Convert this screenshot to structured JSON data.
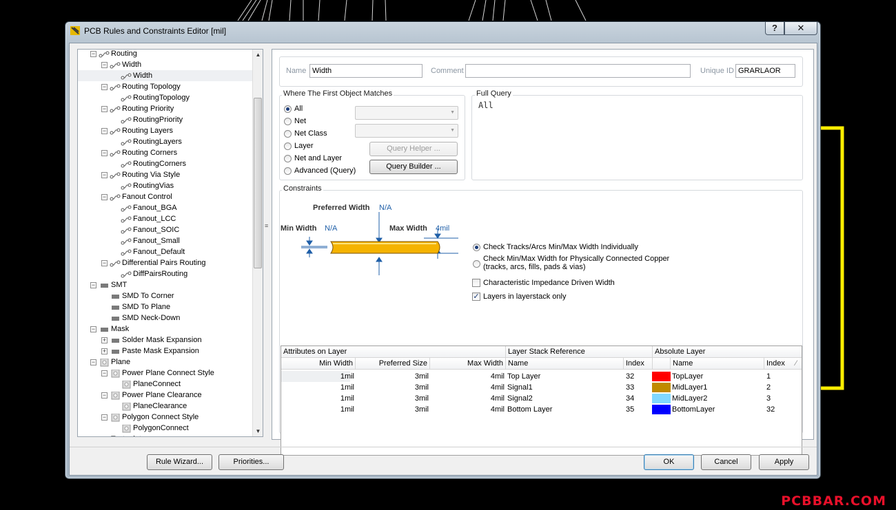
{
  "window": {
    "title": "PCB Rules and Constraints Editor [mil]",
    "help_label": "?",
    "close_label": "✕"
  },
  "watermark": "PCBBAR.COM",
  "tree": {
    "items": [
      {
        "label": "Routing",
        "level": 0,
        "icon": "rule-category-icon",
        "expander": "−"
      },
      {
        "label": "Width",
        "level": 1,
        "icon": "rule-category-icon",
        "expander": "−"
      },
      {
        "label": "Width",
        "level": 2,
        "icon": "rule-icon",
        "expander": "",
        "selected": true
      },
      {
        "label": "Routing Topology",
        "level": 1,
        "icon": "rule-category-icon",
        "expander": "−"
      },
      {
        "label": "RoutingTopology",
        "level": 2,
        "icon": "rule-icon",
        "expander": ""
      },
      {
        "label": "Routing Priority",
        "level": 1,
        "icon": "rule-category-icon",
        "expander": "−"
      },
      {
        "label": "RoutingPriority",
        "level": 2,
        "icon": "rule-icon",
        "expander": ""
      },
      {
        "label": "Routing Layers",
        "level": 1,
        "icon": "rule-category-icon",
        "expander": "−"
      },
      {
        "label": "RoutingLayers",
        "level": 2,
        "icon": "rule-icon",
        "expander": ""
      },
      {
        "label": "Routing Corners",
        "level": 1,
        "icon": "rule-category-icon",
        "expander": "−"
      },
      {
        "label": "RoutingCorners",
        "level": 2,
        "icon": "rule-icon",
        "expander": ""
      },
      {
        "label": "Routing Via Style",
        "level": 1,
        "icon": "rule-category-icon",
        "expander": "−"
      },
      {
        "label": "RoutingVias",
        "level": 2,
        "icon": "rule-icon",
        "expander": ""
      },
      {
        "label": "Fanout Control",
        "level": 1,
        "icon": "rule-category-icon",
        "expander": "−"
      },
      {
        "label": "Fanout_BGA",
        "level": 2,
        "icon": "rule-icon",
        "expander": ""
      },
      {
        "label": "Fanout_LCC",
        "level": 2,
        "icon": "rule-icon",
        "expander": ""
      },
      {
        "label": "Fanout_SOIC",
        "level": 2,
        "icon": "rule-icon",
        "expander": ""
      },
      {
        "label": "Fanout_Small",
        "level": 2,
        "icon": "rule-icon",
        "expander": ""
      },
      {
        "label": "Fanout_Default",
        "level": 2,
        "icon": "rule-icon",
        "expander": ""
      },
      {
        "label": "Differential Pairs Routing",
        "level": 1,
        "icon": "rule-category-icon",
        "expander": "−"
      },
      {
        "label": "DiffPairsRouting",
        "level": 2,
        "icon": "rule-icon",
        "expander": ""
      },
      {
        "label": "SMT",
        "level": 0,
        "icon": "smt-icon",
        "expander": "−"
      },
      {
        "label": "SMD To Corner",
        "level": 1,
        "icon": "smt-icon",
        "expander": ""
      },
      {
        "label": "SMD To Plane",
        "level": 1,
        "icon": "smt-icon",
        "expander": ""
      },
      {
        "label": "SMD Neck-Down",
        "level": 1,
        "icon": "smt-icon",
        "expander": ""
      },
      {
        "label": "Mask",
        "level": 0,
        "icon": "mask-icon",
        "expander": "−"
      },
      {
        "label": "Solder Mask Expansion",
        "level": 1,
        "icon": "mask-icon",
        "expander": "+"
      },
      {
        "label": "Paste Mask Expansion",
        "level": 1,
        "icon": "mask-icon",
        "expander": "+"
      },
      {
        "label": "Plane",
        "level": 0,
        "icon": "plane-icon",
        "expander": "−"
      },
      {
        "label": "Power Plane Connect Style",
        "level": 1,
        "icon": "plane-icon",
        "expander": "−"
      },
      {
        "label": "PlaneConnect",
        "level": 2,
        "icon": "plane-icon",
        "expander": ""
      },
      {
        "label": "Power Plane Clearance",
        "level": 1,
        "icon": "plane-icon",
        "expander": "−"
      },
      {
        "label": "PlaneClearance",
        "level": 2,
        "icon": "plane-icon",
        "expander": ""
      },
      {
        "label": "Polygon Connect Style",
        "level": 1,
        "icon": "plane-icon",
        "expander": "−"
      },
      {
        "label": "PolygonConnect",
        "level": 2,
        "icon": "plane-icon",
        "expander": ""
      },
      {
        "label": "Testpoint",
        "level": 0,
        "icon": "testpoint-icon",
        "expander": "−"
      }
    ]
  },
  "rule": {
    "name_label": "Name",
    "name_value": "Width",
    "comment_label": "Comment",
    "comment_value": "",
    "uid_label": "Unique ID",
    "uid_value": "GRARLAOR"
  },
  "match": {
    "group_label": "Where The First Object Matches",
    "options": [
      "All",
      "Net",
      "Net Class",
      "Layer",
      "Net and Layer",
      "Advanced (Query)"
    ],
    "selected": "All",
    "query_helper": "Query Helper ...",
    "query_builder": "Query Builder ..."
  },
  "full_query": {
    "label": "Full Query",
    "text": "All"
  },
  "constraints": {
    "group_label": "Constraints",
    "preferred_label": "Preferred Width",
    "preferred_value": "N/A",
    "min_label": "Min Width",
    "min_value": "N/A",
    "max_label": "Max Width",
    "max_value": "4mil",
    "check_individual": "Check Tracks/Arcs Min/Max Width Individually",
    "check_copper_1": "Check Min/Max Width for Physically Connected Copper",
    "check_copper_2": "(tracks, arcs, fills, pads & vias)",
    "impedance": "Characteristic Impedance Driven Width",
    "layerstack_only": "Layers in layerstack only",
    "layerstack_checked": true,
    "impedance_checked": false
  },
  "grid": {
    "group_headers": [
      "Attributes on Layer",
      "Layer Stack Reference",
      "Absolute Layer"
    ],
    "columns": [
      "Min Width",
      "Preferred Size",
      "Max Width",
      "Name",
      "Index",
      "Name",
      "Index"
    ],
    "rows": [
      {
        "min": "1mil",
        "pref": "3mil",
        "max": "4mil",
        "ls_name": "Top Layer",
        "ls_index": "32",
        "color": "#ff0000",
        "abs_name": "TopLayer",
        "abs_index": "1"
      },
      {
        "min": "1mil",
        "pref": "3mil",
        "max": "4mil",
        "ls_name": "Signal1",
        "ls_index": "33",
        "color": "#c08a00",
        "abs_name": "MidLayer1",
        "abs_index": "2"
      },
      {
        "min": "1mil",
        "pref": "3mil",
        "max": "4mil",
        "ls_name": "Signal2",
        "ls_index": "34",
        "color": "#80d8ff",
        "abs_name": "MidLayer2",
        "abs_index": "3"
      },
      {
        "min": "1mil",
        "pref": "3mil",
        "max": "4mil",
        "ls_name": "Bottom Layer",
        "ls_index": "35",
        "color": "#0000ff",
        "abs_name": "BottomLayer",
        "abs_index": "32"
      }
    ]
  },
  "footer": {
    "rule_wizard": "Rule Wizard...",
    "priorities": "Priorities...",
    "ok": "OK",
    "cancel": "Cancel",
    "apply": "Apply"
  }
}
